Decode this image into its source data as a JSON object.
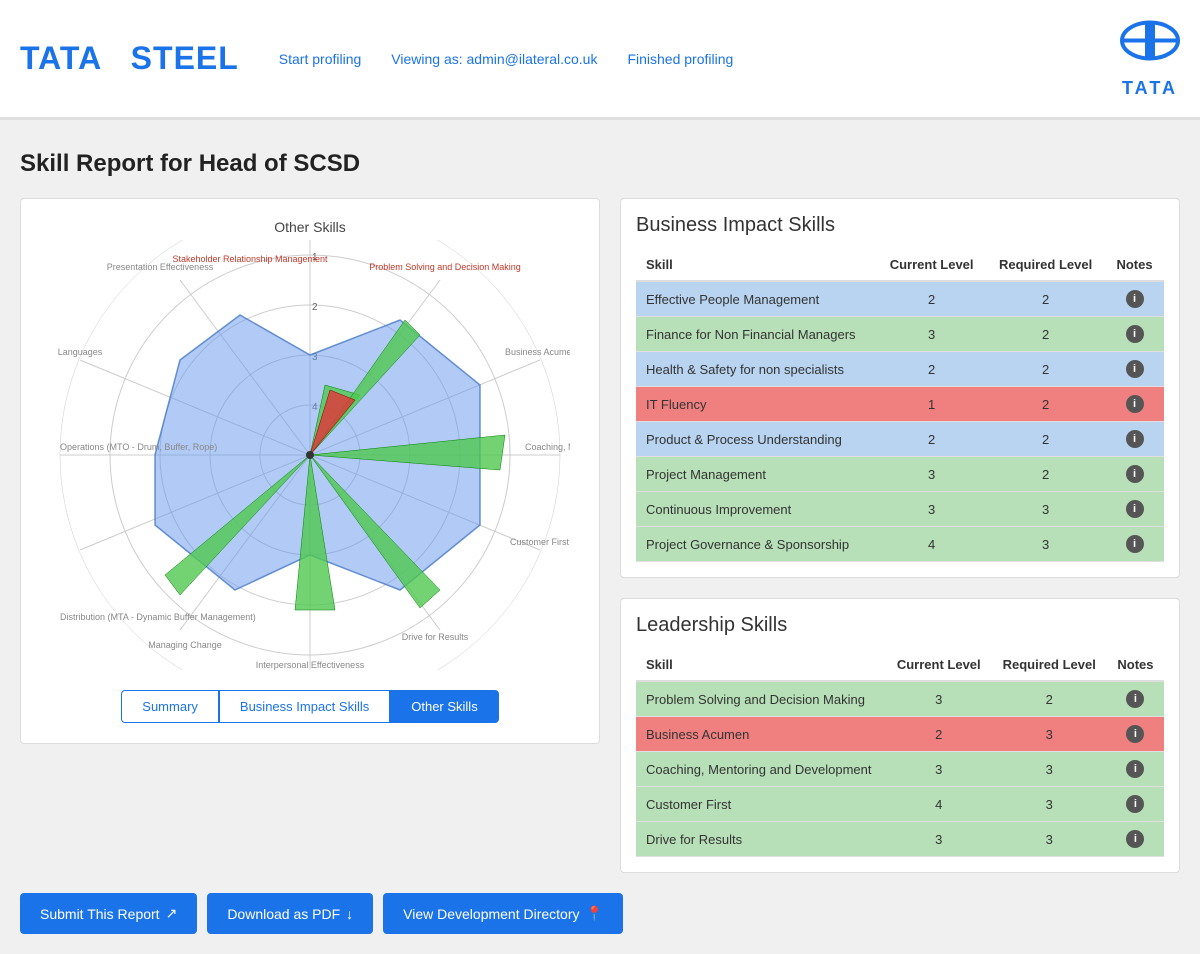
{
  "header": {
    "logo": "TATA STEEL",
    "logo_tata": "TATA",
    "logo_steel": "STEEL",
    "nav": {
      "start_profiling": "Start profiling",
      "viewing_as": "Viewing as: admin@ilateral.co.uk",
      "finished_profiling": "Finished profiling"
    },
    "tata_right": "TATA"
  },
  "page": {
    "title": "Skill Report for Head of SCSD"
  },
  "tabs": {
    "summary": "Summary",
    "business_impact": "Business Impact Skills",
    "other_skills": "Other Skills"
  },
  "radar": {
    "title": "Other Skills",
    "labels": [
      "Stakeholder Relationship Management",
      "Problem Solving and Decision Making",
      "Business Acumen",
      "Coaching, Mentoring and Development",
      "Customer First",
      "Drive for Results",
      "Interpersonal Effectiveness",
      "Managing Change",
      "Distribution (MTA - Dynamic Buffer Management)",
      "Operations (MTO - Drum, Buffer, Rope)",
      "Languages",
      "Presentation Effectiveness"
    ]
  },
  "business_impact": {
    "title": "Business Impact Skills",
    "columns": [
      "Skill",
      "Current Level",
      "Required Level",
      "Notes"
    ],
    "rows": [
      {
        "skill": "Effective People Management",
        "current": 2,
        "required": 2,
        "color": "blue"
      },
      {
        "skill": "Finance for Non Financial Managers",
        "current": 3,
        "required": 2,
        "color": "green"
      },
      {
        "skill": "Health & Safety for non specialists",
        "current": 2,
        "required": 2,
        "color": "blue"
      },
      {
        "skill": "IT Fluency",
        "current": 1,
        "required": 2,
        "color": "red"
      },
      {
        "skill": "Product & Process Understanding",
        "current": 2,
        "required": 2,
        "color": "blue"
      },
      {
        "skill": "Project Management",
        "current": 3,
        "required": 2,
        "color": "green"
      },
      {
        "skill": "Continuous Improvement",
        "current": 3,
        "required": 3,
        "color": "green"
      },
      {
        "skill": "Project Governance & Sponsorship",
        "current": 4,
        "required": 3,
        "color": "green"
      }
    ]
  },
  "leadership": {
    "title": "Leadership Skills",
    "columns": [
      "Skill",
      "Current Level",
      "Required Level",
      "Notes"
    ],
    "rows": [
      {
        "skill": "Problem Solving and Decision Making",
        "current": 3,
        "required": 2,
        "color": "green"
      },
      {
        "skill": "Business Acumen",
        "current": 2,
        "required": 3,
        "color": "red"
      },
      {
        "skill": "Coaching, Mentoring and Development",
        "current": 3,
        "required": 3,
        "color": "green"
      },
      {
        "skill": "Customer First",
        "current": 4,
        "required": 3,
        "color": "green"
      },
      {
        "skill": "Drive for Results",
        "current": 3,
        "required": 3,
        "color": "green"
      }
    ]
  },
  "buttons": {
    "submit": "Submit This Report",
    "download": "Download as PDF",
    "view_directory": "View Development Directory"
  }
}
